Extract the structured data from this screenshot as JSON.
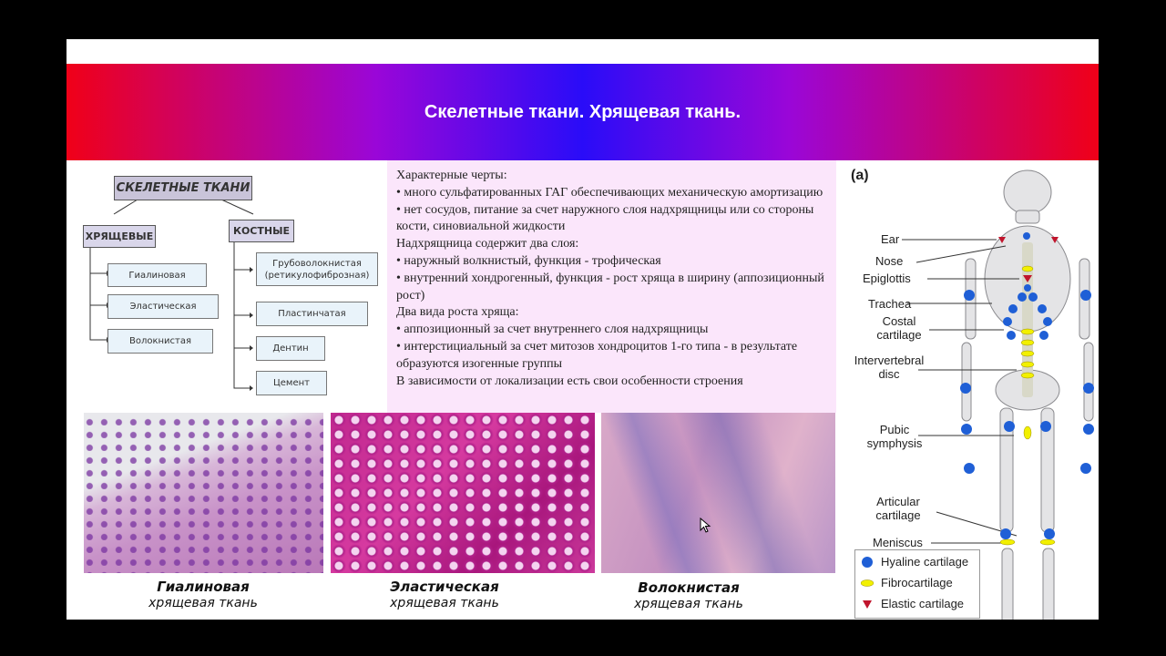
{
  "slide": {
    "title": "Скелетные ткани. Хрящевая ткань."
  },
  "tree": {
    "root": "СКЕЛЕТНЫЕ ТКАНИ",
    "cartilage": {
      "label": "ХРЯЩЕВЫЕ",
      "items": [
        "Гиалиновая",
        "Эластическая",
        "Волокнистая"
      ]
    },
    "bone": {
      "label": "КОСТНЫЕ",
      "items": [
        "Грубоволокнистая (ретикулофиброзная)",
        "Пластинчатая",
        "Дентин",
        "Цемент"
      ]
    }
  },
  "info": {
    "lines": [
      "Характерные черты:",
      "• много сульфатированных ГАГ обеспечивающих механическую амортизацию",
      "• нет сосудов, питание за счет наружного слоя надхрящницы или со стороны кости, синовиальной жидкости",
      "Надхрящница содержит два слоя:",
      "• наружный волкнистый, функция - трофическая",
      "• внутренний хондрогенный, функция - рост хряща в ширину (аппозиционный рост)",
      "Два вида роста хряща:",
      "• аппозиционный за счет внутреннего слоя надхрящницы",
      "• интерстициальный за счет митозов хондроцитов 1-го типа - в результате образуются изогенные группы",
      "В зависимости от локализации есть свои особенности строения"
    ]
  },
  "micrographs": [
    {
      "title": "Гиалиновая",
      "subtitle": "хрящевая ткань"
    },
    {
      "title": "Эластическая",
      "subtitle": "хрящевая ткань"
    },
    {
      "title": "Волокнистая",
      "subtitle": "хрящевая ткань"
    }
  ],
  "skeleton": {
    "panel_label": "(a)",
    "labels": {
      "ear": "Ear",
      "nose": "Nose",
      "epiglottis": "Epiglottis",
      "trachea": "Trachea",
      "costal": "Costal cartilage",
      "intervertebral": "Intervertebral disc",
      "pubic": "Pubic symphysis",
      "articular": "Articular cartilage",
      "meniscus": "Meniscus"
    },
    "legend": [
      {
        "label": "Hyaline cartilage",
        "color": "#1f5fd6",
        "shape": "circle"
      },
      {
        "label": "Fibrocartilage",
        "color": "#f2f000",
        "shape": "ellipse"
      },
      {
        "label": "Elastic cartilage",
        "color": "#c0142c",
        "shape": "triangle"
      }
    ]
  }
}
